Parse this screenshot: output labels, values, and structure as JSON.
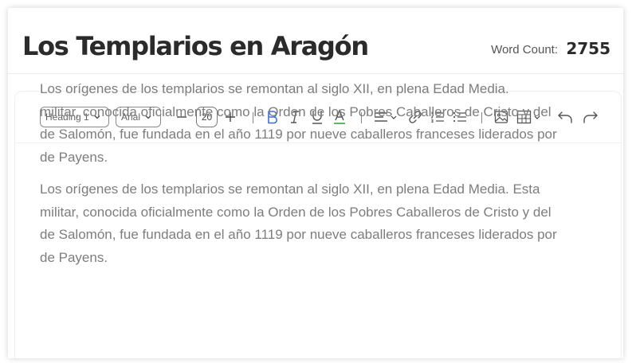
{
  "header": {
    "title": "Los Templarios en Aragón",
    "word_count_label": "Word Count:",
    "word_count_value": "2755"
  },
  "toolbar": {
    "heading_select": "Heading 1",
    "font_select": "Arial",
    "font_size": "20",
    "icons": [
      "minus-icon",
      "plus-icon",
      "bold-icon",
      "italic-icon",
      "underline-icon",
      "text-color-icon",
      "align-icon",
      "link-icon",
      "ordered-list-icon",
      "bullet-list-icon",
      "image-icon",
      "table-icon",
      "undo-icon",
      "redo-icon"
    ],
    "colors": {
      "bold_active": "#3b6fd8",
      "text_color_underline": "#5cb85c"
    }
  },
  "content": {
    "paragraphs": [
      {
        "lines": [
          "Los orígenes de los templarios se remontan al siglo XII, en plena Edad Media.",
          "militar, conocida oficialmente como la Orden de los Pobres Caballeros de Cristo y del",
          "de Salomón, fue fundada en el año 1119 por nueve caballeros franceses liderados por",
          "de Payens."
        ]
      },
      {
        "lines": [
          "Los orígenes de los templarios se remontan al siglo XII, en plena Edad Media. Esta",
          "militar, conocida oficialmente como la Orden de los Pobres Caballeros de Cristo y del",
          "de Salomón, fue fundada en el año 1119 por nueve caballeros franceses liderados por",
          "de Payens."
        ]
      }
    ]
  }
}
